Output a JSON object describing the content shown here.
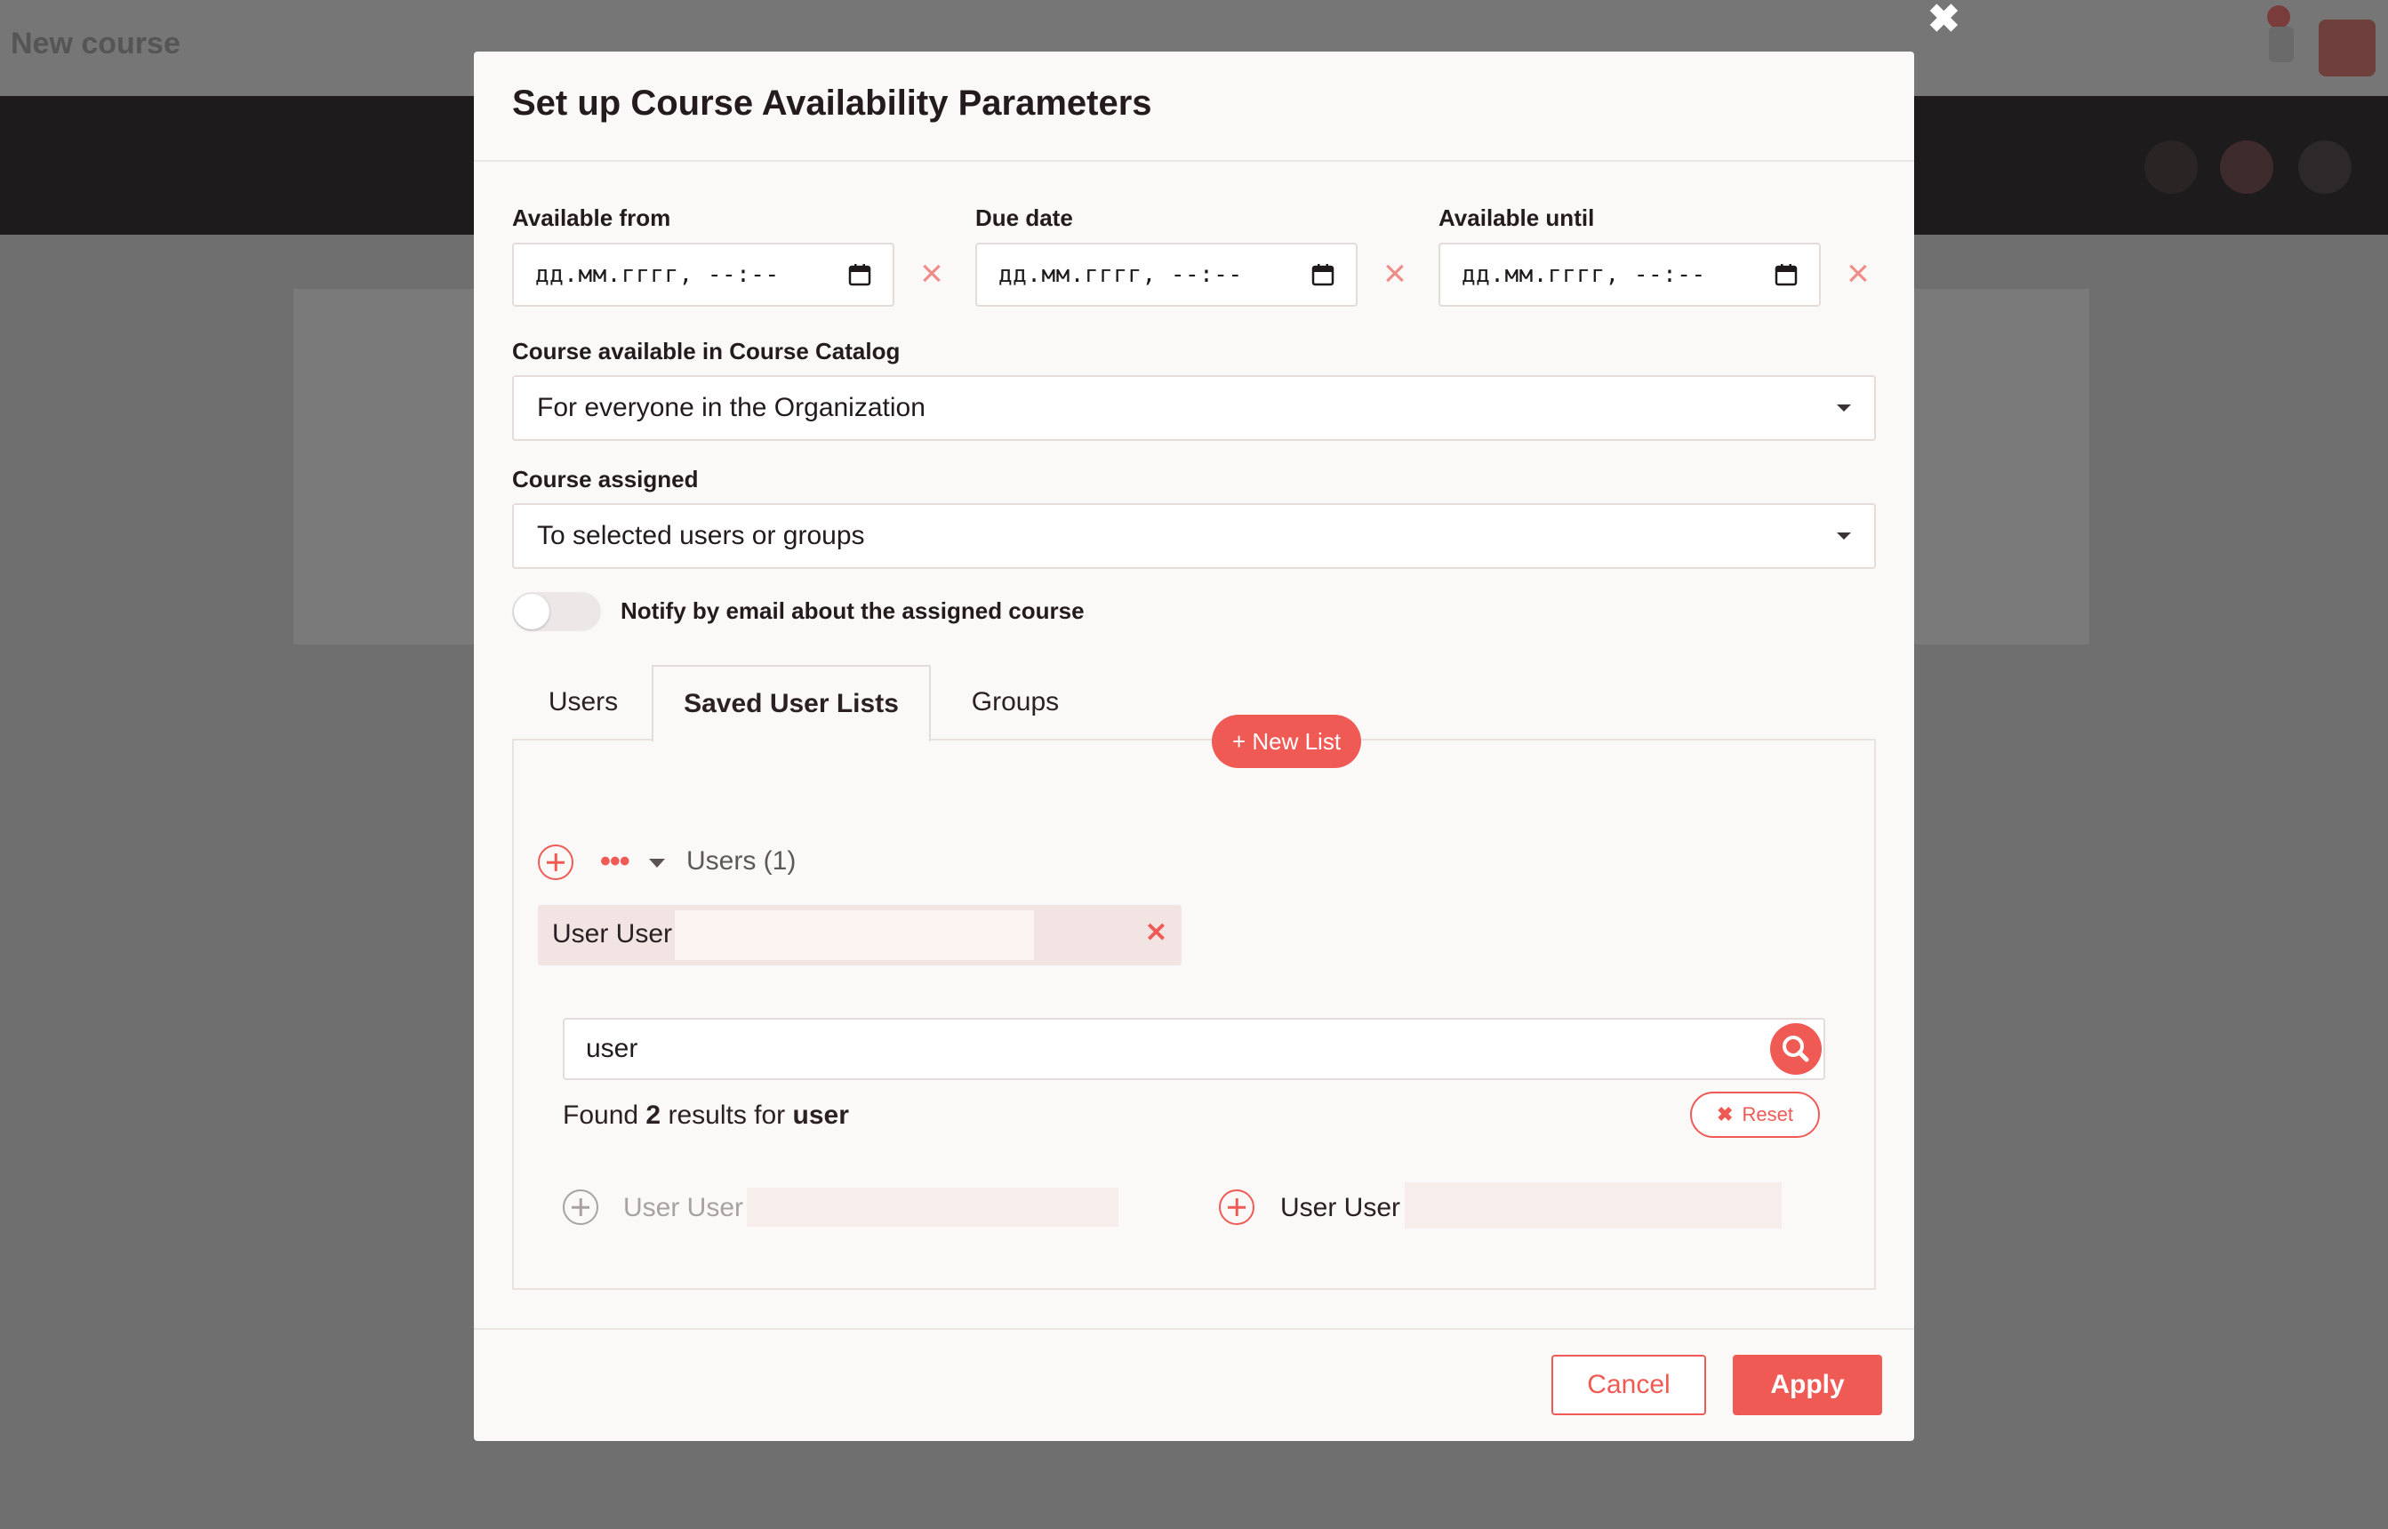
{
  "background": {
    "page_title": "New course"
  },
  "modal": {
    "title": "Set up Course Availability Parameters",
    "close_icon": "close-icon",
    "dates": {
      "available_from": {
        "label": "Available from",
        "placeholder": "дд.мм.гггг, --:--"
      },
      "due_date": {
        "label": "Due date",
        "placeholder": "дд.мм.гггг, --:--"
      },
      "available_until": {
        "label": "Available until",
        "placeholder": "дд.мм.гггг, --:--"
      }
    },
    "catalog": {
      "label": "Course available in Course Catalog",
      "value": "For everyone in the Organization"
    },
    "assigned": {
      "label": "Course assigned",
      "value": "To selected users or groups"
    },
    "notify": {
      "label": "Notify by email about the assigned course",
      "enabled": false
    },
    "tabs": [
      {
        "label": "Users",
        "active": false
      },
      {
        "label": "Saved User Lists",
        "active": true
      },
      {
        "label": "Groups",
        "active": false
      }
    ],
    "saved_lists": {
      "new_list_label": "+ New List",
      "group_title": "Users (1)",
      "chip": {
        "name": "User User"
      }
    },
    "search": {
      "value": "user",
      "found_prefix": "Found",
      "found_count": "2",
      "found_middle": "results for",
      "found_query": "user",
      "reset_label": "Reset"
    },
    "results": [
      {
        "name": "User User",
        "disabled": true
      },
      {
        "name": "User User",
        "disabled": false
      }
    ],
    "footer": {
      "cancel_label": "Cancel",
      "apply_label": "Apply"
    }
  },
  "colors": {
    "accent": "#f05a55",
    "overlay": "#6f6f6f",
    "modal_bg": "#fbf9f8"
  }
}
